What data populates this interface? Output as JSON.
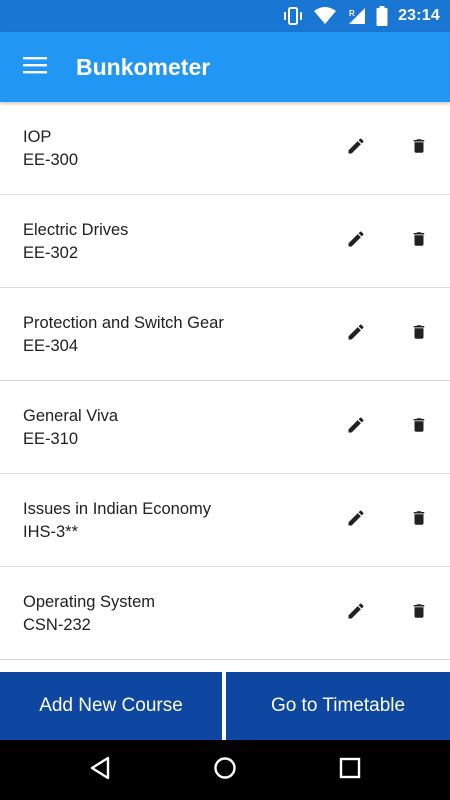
{
  "status_bar": {
    "time": "23:14",
    "icons": [
      "vibrate-icon",
      "wifi-icon",
      "signal-roaming-icon",
      "battery-icon"
    ],
    "color": "#1976D2"
  },
  "app_bar": {
    "title": "Bunkometer",
    "menu_icon": "hamburger-menu-icon",
    "color": "#2196F3"
  },
  "courses": [
    {
      "name": "IOP",
      "code": "EE-300"
    },
    {
      "name": "Electric Drives",
      "code": "EE-302"
    },
    {
      "name": "Protection and Switch Gear",
      "code": "EE-304"
    },
    {
      "name": "General Viva",
      "code": "EE-310"
    },
    {
      "name": "Issues in Indian Economy",
      "code": "IHS-3**"
    },
    {
      "name": "Operating System",
      "code": "CSN-232"
    }
  ],
  "row_actions": {
    "edit_icon": "pencil-icon",
    "delete_icon": "trash-icon"
  },
  "bottom_actions": {
    "add_label": "Add New Course",
    "timetable_label": "Go to Timetable",
    "color": "#0D47A1"
  },
  "nav_bar": {
    "icons": [
      "back-icon",
      "home-icon",
      "recents-icon"
    ]
  }
}
